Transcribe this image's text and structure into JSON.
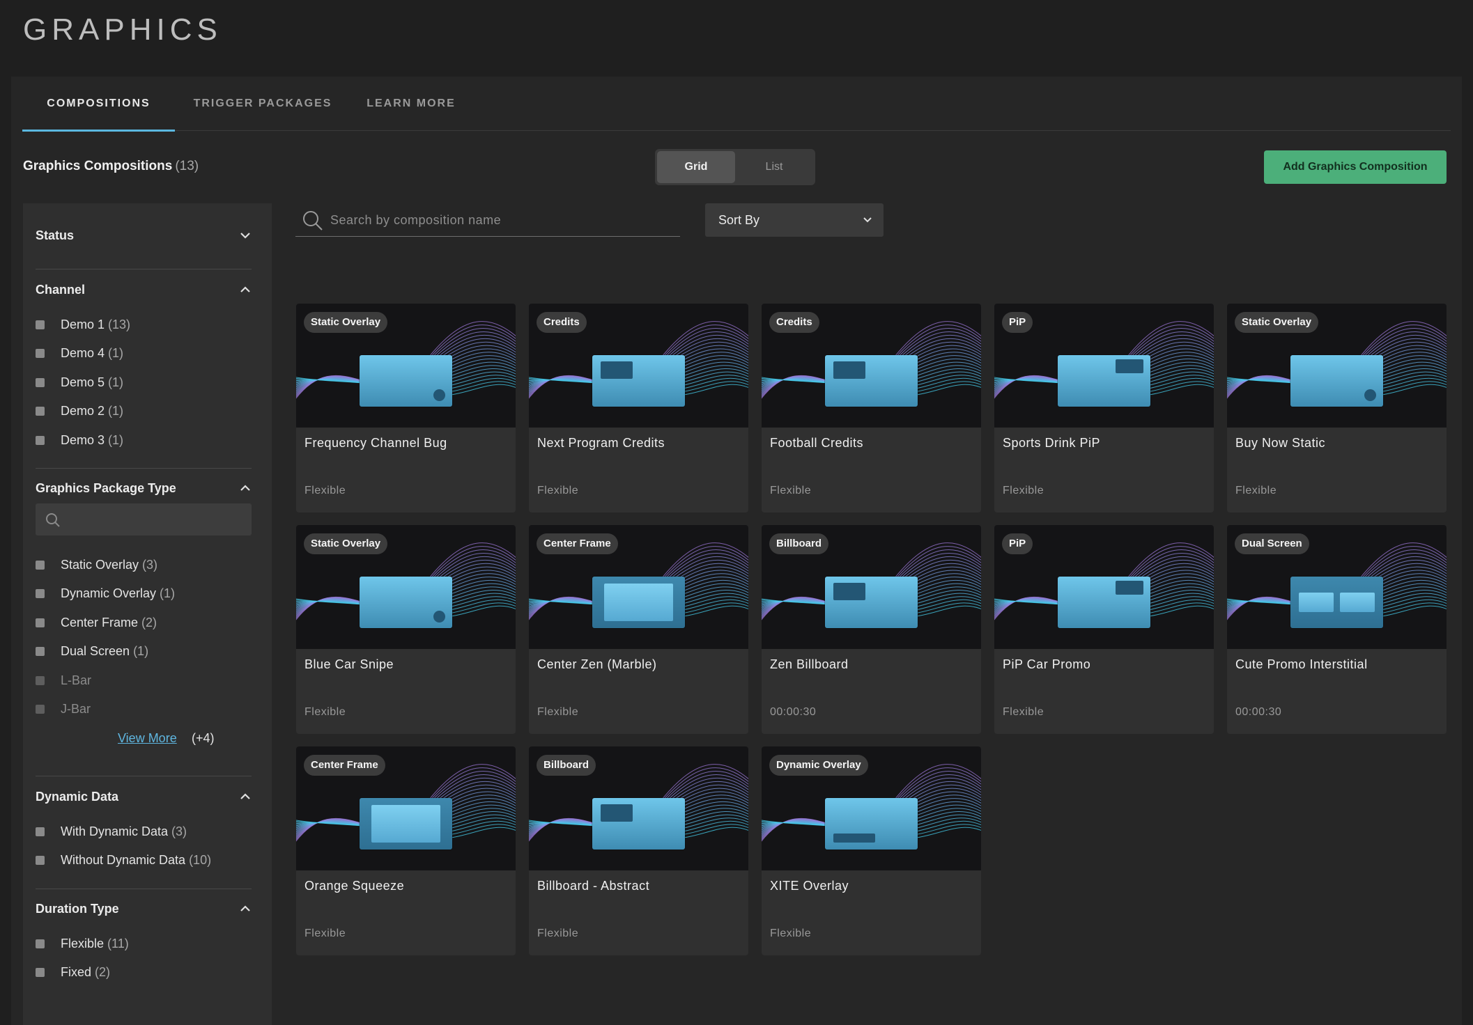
{
  "page_title": "GRAPHICS",
  "tabs": [
    {
      "label": "COMPOSITIONS",
      "active": true
    },
    {
      "label": "TRIGGER PACKAGES",
      "active": false
    },
    {
      "label": "LEARN MORE",
      "active": false
    }
  ],
  "header": {
    "title": "Graphics Compositions",
    "count": "(13)"
  },
  "view_toggle": {
    "grid": "Grid",
    "list": "List",
    "selected": "Grid"
  },
  "add_button": "Add Graphics Composition",
  "search": {
    "placeholder": "Search by composition name",
    "value": ""
  },
  "sort": {
    "label": "Sort By"
  },
  "sidebar": {
    "status": {
      "title": "Status",
      "expanded": false
    },
    "channel": {
      "title": "Channel",
      "options": [
        {
          "label": "Demo 1",
          "count": "(13)"
        },
        {
          "label": "Demo 4",
          "count": "(1)"
        },
        {
          "label": "Demo 5",
          "count": "(1)"
        },
        {
          "label": "Demo 2",
          "count": "(1)"
        },
        {
          "label": "Demo 3",
          "count": "(1)"
        }
      ]
    },
    "package_type": {
      "title": "Graphics Package Type",
      "search_placeholder": "",
      "options": [
        {
          "label": "Static Overlay",
          "count": "(3)"
        },
        {
          "label": "Dynamic Overlay",
          "count": "(1)"
        },
        {
          "label": "Center Frame",
          "count": "(2)"
        },
        {
          "label": "Dual Screen",
          "count": "(1)"
        },
        {
          "label": "L-Bar",
          "count": ""
        },
        {
          "label": "J-Bar",
          "count": ""
        }
      ],
      "view_more": "View More",
      "view_more_count": "(+4)"
    },
    "dynamic_data": {
      "title": "Dynamic Data",
      "options": [
        {
          "label": "With Dynamic Data",
          "count": "(3)"
        },
        {
          "label": "Without Dynamic Data",
          "count": "(10)"
        }
      ]
    },
    "duration_type": {
      "title": "Duration Type",
      "options": [
        {
          "label": "Flexible",
          "count": "(11)"
        },
        {
          "label": "Fixed",
          "count": "(2)"
        }
      ]
    }
  },
  "cards": [
    {
      "badge": "Static Overlay",
      "title": "Frequency Channel Bug",
      "meta": "Flexible",
      "thumb": "dot"
    },
    {
      "badge": "Credits",
      "title": "Next Program Credits",
      "meta": "Flexible",
      "thumb": "tl"
    },
    {
      "badge": "Credits",
      "title": "Football Credits",
      "meta": "Flexible",
      "thumb": "tl"
    },
    {
      "badge": "PiP",
      "title": "Sports Drink PiP",
      "meta": "Flexible",
      "thumb": "tr"
    },
    {
      "badge": "Static Overlay",
      "title": "Buy Now Static",
      "meta": "Flexible",
      "thumb": "dot"
    },
    {
      "badge": "Static Overlay",
      "title": "Blue Car Snipe",
      "meta": "Flexible",
      "thumb": "dot"
    },
    {
      "badge": "Center Frame",
      "title": "Center Zen (Marble)",
      "meta": "Flexible",
      "thumb": "frame"
    },
    {
      "badge": "Billboard",
      "title": "Zen Billboard",
      "meta": "00:00:30",
      "thumb": "tl"
    },
    {
      "badge": "PiP",
      "title": "PiP Car Promo",
      "meta": "Flexible",
      "thumb": "tr"
    },
    {
      "badge": "Dual Screen",
      "title": "Cute Promo Interstitial",
      "meta": "00:00:30",
      "thumb": "dual"
    },
    {
      "badge": "Center Frame",
      "title": "Orange Squeeze",
      "meta": "Flexible",
      "thumb": "frame"
    },
    {
      "badge": "Billboard",
      "title": "Billboard - Abstract",
      "meta": "Flexible",
      "thumb": "tl"
    },
    {
      "badge": "Dynamic Overlay",
      "title": "XITE Overlay",
      "meta": "Flexible",
      "thumb": "bl"
    }
  ],
  "colors": {
    "accent": "#5bb8e0",
    "add_button": "#4caf7a",
    "background": "#1f1f1f",
    "panel": "#262626"
  }
}
